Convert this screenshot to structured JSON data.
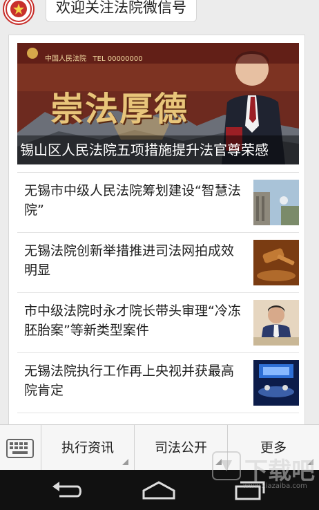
{
  "chat": {
    "welcome_message": "欢迎关注法院微信号"
  },
  "article_card": {
    "banner": {
      "caption": "锡山区人民法院五项措施提升法官尊荣感",
      "calligraphy": "崇法厚德",
      "logo_text": "中国人民法院",
      "tel_text": "TEL 00000000"
    },
    "items": [
      {
        "title": "无锡市中级人民法院筹划建设“智慧法院”"
      },
      {
        "title": "无锡法院创新举措推进司法网拍成效明显"
      },
      {
        "title": "市中级法院时永才院长带头审理“冷冻胚胎案”等新类型案件"
      },
      {
        "title": "无锡法院执行工作再上央视并获最高院肯定"
      }
    ]
  },
  "bottom_menu": {
    "items": [
      {
        "label": "执行资讯"
      },
      {
        "label": "司法公开"
      },
      {
        "label": "更多"
      }
    ]
  },
  "watermark": {
    "text": "下载吧",
    "url_text": "www.xiazaiba.com"
  },
  "colors": {
    "brand_red": "#c8302c",
    "navbar": "#111111",
    "menu_bg": "#f6f6f6"
  }
}
